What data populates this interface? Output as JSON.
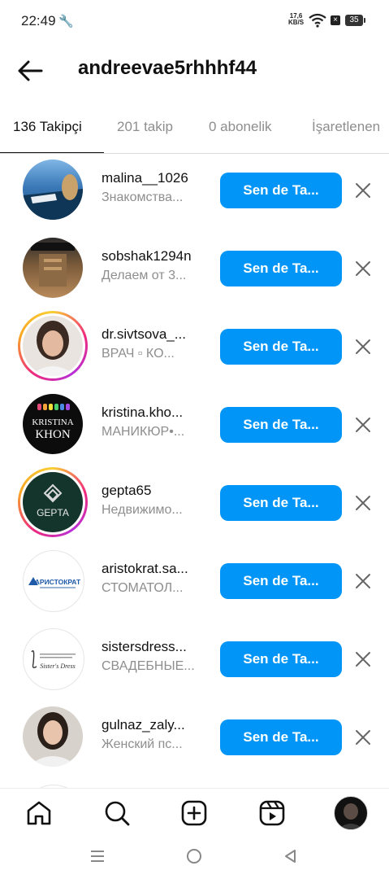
{
  "status": {
    "time": "22:49",
    "net_speed_top": "17,6",
    "net_speed_bottom": "KB/S",
    "battery": "35"
  },
  "header": {
    "title": "andreevae5rhhhf44"
  },
  "tabs": [
    {
      "label": "136 Takipçi"
    },
    {
      "label": "201 takip"
    },
    {
      "label": "0 abonelik"
    },
    {
      "label": "İşaretlenen"
    }
  ],
  "follow_label": "Sen de Ta...",
  "followers": [
    {
      "username": "malina__1026",
      "subtitle": "Знакомства..."
    },
    {
      "username": "sobshak1294n",
      "subtitle": "Делаем от 3..."
    },
    {
      "username": "dr.sivtsova_...",
      "subtitle": "ВРАЧ ▫ КО..."
    },
    {
      "username": "kristina.kho...",
      "subtitle": "МАНИКЮР•..."
    },
    {
      "username": "gepta65",
      "subtitle": "Недвижимо..."
    },
    {
      "username": "aristokrat.sa...",
      "subtitle": "СТОМАТОЛ..."
    },
    {
      "username": "sistersdress...",
      "subtitle": "СВАДЕБНЫЕ..."
    },
    {
      "username": "gulnaz_zaly...",
      "subtitle": "Женский пс..."
    }
  ],
  "avatar_text": {
    "kristina_line1": "KRISTINA",
    "kristina_line2": "KHON",
    "gepta": "GEPTA",
    "aristokrat": "АРИСТОКРАТ",
    "sisters": "Sister's Dress"
  },
  "colors": {
    "accent": "#0095f6",
    "story_ring": "#ee2a7b"
  }
}
